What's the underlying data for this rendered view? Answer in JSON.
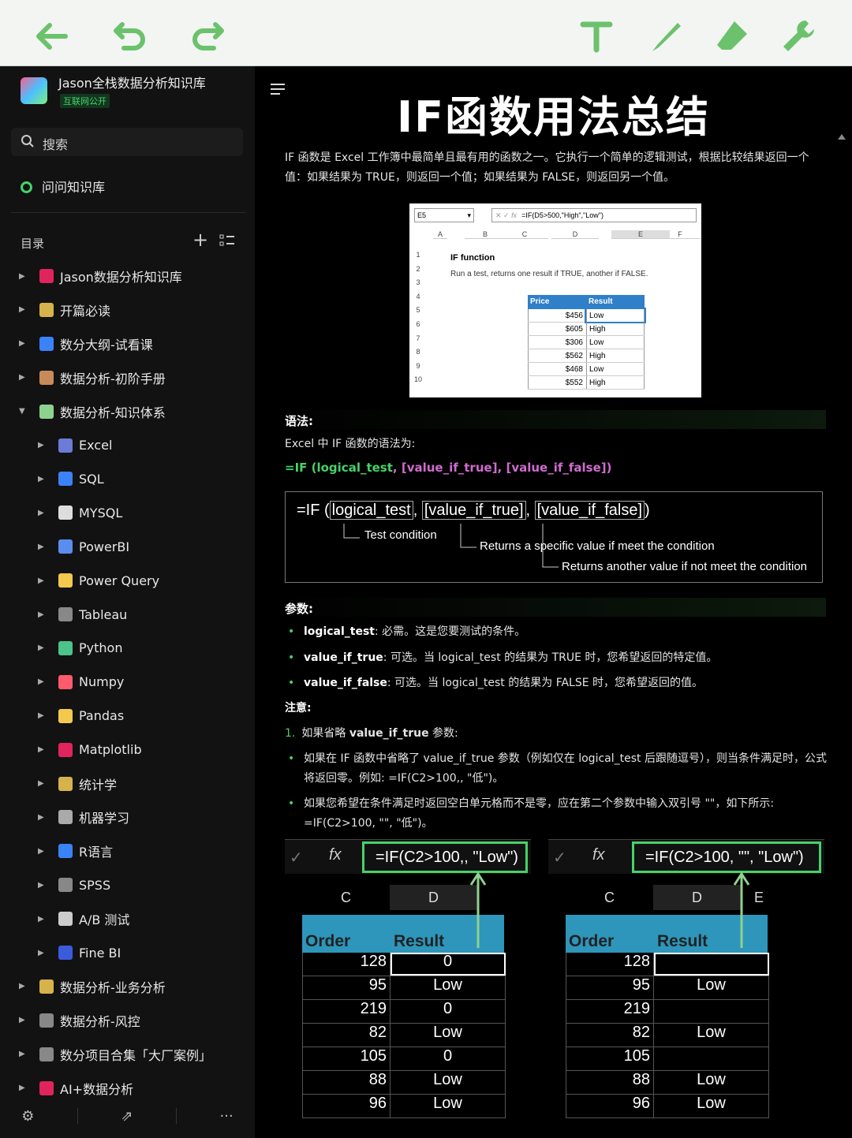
{
  "toolbar": {
    "icons": [
      "back-arrow-icon",
      "undo-icon",
      "redo-icon",
      "text-icon",
      "pen-icon",
      "eraser-icon",
      "wrench-icon"
    ],
    "accent": "#6cc26c"
  },
  "sidebar": {
    "workspace_name": "Jason全栈数据分析知识库",
    "workspace_tag": "互联网公开",
    "search_label": "搜索",
    "ask_label": "问问知识库",
    "toc_label": "目录",
    "items": [
      {
        "label": "Jason数据分析知识库",
        "level": 0,
        "icon": "folder-icon",
        "color": "#e0245e"
      },
      {
        "label": "开篇必读",
        "level": 0,
        "icon": "pencil-icon",
        "color": "#d6b24c"
      },
      {
        "label": "数分大纲-试看课",
        "level": 0,
        "icon": "diamond-icon",
        "color": "#3b82f6"
      },
      {
        "label": "数据分析-初阶手册",
        "level": 0,
        "icon": "hourglass-icon",
        "color": "#c98a5a"
      },
      {
        "label": "数据分析-知识体系",
        "level": 0,
        "icon": "music-icon",
        "color": "#8fd18f",
        "expanded": true
      },
      {
        "label": "Excel",
        "level": 1,
        "icon": "excel-icon",
        "color": "#6c7bd6"
      },
      {
        "label": "SQL",
        "level": 1,
        "icon": "sql-icon",
        "color": "#3b82f6"
      },
      {
        "label": "MYSQL",
        "level": 1,
        "icon": "mysql-icon",
        "color": "#dddddd"
      },
      {
        "label": "PowerBI",
        "level": 1,
        "icon": "powerbi-icon",
        "color": "#5b8def"
      },
      {
        "label": "Power Query",
        "level": 1,
        "icon": "powerquery-icon",
        "color": "#f2c94c"
      },
      {
        "label": "Tableau",
        "level": 1,
        "icon": "tableau-icon",
        "color": "#888888"
      },
      {
        "label": "Python",
        "level": 1,
        "icon": "python-icon",
        "color": "#4cc38a"
      },
      {
        "label": "Numpy",
        "level": 1,
        "icon": "numpy-icon",
        "color": "#ff5a6e"
      },
      {
        "label": "Pandas",
        "level": 1,
        "icon": "pandas-icon",
        "color": "#f2c94c"
      },
      {
        "label": "Matplotlib",
        "level": 1,
        "icon": "matplotlib-icon",
        "color": "#e0245e"
      },
      {
        "label": "统计学",
        "level": 1,
        "icon": "stats-icon",
        "color": "#d6b24c"
      },
      {
        "label": "机器学习",
        "level": 1,
        "icon": "robot-icon",
        "color": "#aaaaaa"
      },
      {
        "label": "R语言",
        "level": 1,
        "icon": "r-icon",
        "color": "#3b82f6"
      },
      {
        "label": "SPSS",
        "level": 1,
        "icon": "spss-icon",
        "color": "#888888"
      },
      {
        "label": "A/B 测试",
        "level": 1,
        "icon": "ab-icon",
        "color": "#cccccc"
      },
      {
        "label": "Fine BI",
        "level": 1,
        "icon": "finebi-icon",
        "color": "#3b5bdb"
      },
      {
        "label": "数据分析-业务分析",
        "level": 0,
        "icon": "trophy-icon",
        "color": "#d6b24c"
      },
      {
        "label": "数据分析-风控",
        "level": 0,
        "icon": "bird-icon",
        "color": "#888888"
      },
      {
        "label": "数分项目合集「大厂案例」",
        "level": 0,
        "icon": "link-icon",
        "color": "#888888"
      },
      {
        "label": "AI+数据分析",
        "level": 0,
        "icon": "ai-icon",
        "color": "#e0245e"
      }
    ],
    "footer_icons": [
      "settings-icon",
      "share-icon",
      "more-icon"
    ]
  },
  "article": {
    "title": "IF函数用法总结",
    "intro": "IF 函数是 Excel 工作簿中最简单且最有用的函数之一。它执行一个简单的逻辑测试，根据比较结果返回一个值：如果结果为 TRUE，则返回一个值；如果结果为 FALSE，则返回另一个值。",
    "fig1": {
      "namebox": "E5",
      "formula": "=IF(D5>500,\"High\",\"Low\")",
      "cols": [
        "A",
        "B",
        "C",
        "D",
        "E",
        "F"
      ],
      "rows": [
        "1",
        "2",
        "3",
        "4",
        "5",
        "6",
        "7",
        "8",
        "9",
        "10"
      ],
      "heading": "IF function",
      "subheading": "Run a test, returns one result if TRUE, another if FALSE.",
      "table_headers": [
        "Price",
        "Result"
      ],
      "table_rows": [
        [
          "$456",
          "Low"
        ],
        [
          "$605",
          "High"
        ],
        [
          "$306",
          "Low"
        ],
        [
          "$562",
          "High"
        ],
        [
          "$468",
          "Low"
        ],
        [
          "$552",
          "High"
        ]
      ]
    },
    "syntax_heading": "语法:",
    "syntax_intro": "Excel 中 IF 函数的语法为:",
    "syntax_formula": {
      "prefix": "=IF (",
      "a1": "logical_test",
      "sep1": ", [",
      "a2": "value_if_true",
      "sep2": "], [",
      "a3": "value_if_false",
      "suffix": "])"
    },
    "diagram": {
      "formula": {
        "p": "=IF (",
        "a": "logical_test",
        "b": "[value_if_true]",
        "c": "[value_if_false]",
        "end": ")"
      },
      "l1": "Test condition",
      "l2": "Returns a specific value if meet the condition",
      "l3": "Returns another value if not meet the condition"
    },
    "params_heading": "参数:",
    "params": [
      {
        "name": "logical_test",
        "desc": ": 必需。这是您要测试的条件。"
      },
      {
        "name": "value_if_true",
        "desc": ": 可选。当 logical_test 的结果为 TRUE 时，您希望返回的特定值。"
      },
      {
        "name": "value_if_false",
        "desc": ": 可选。当 logical_test 的结果为 FALSE 时，您希望返回的值。"
      }
    ],
    "note_heading": "注意:",
    "note1": {
      "num": "1.",
      "text": "如果省略 ",
      "bold": "value_if_true",
      "tail": " 参数:"
    },
    "note_b1": "如果在 IF 函数中省略了 value_if_true 参数（例如仅在 logical_test 后跟随逗号），则当条件满足时，公式将返回零。例如: =IF(C2>100,, \"低\")。",
    "note_b2": "如果您希望在条件满足时返回空白单元格而不是零，应在第二个参数中输入双引号 \"\"，如下所示: =IF(C2>100, \"\", \"低\")。",
    "ex_left": {
      "formula": "=IF(C2>100,, \"Low\")",
      "cols": [
        "C",
        "D"
      ],
      "headers": [
        "Order",
        "Result"
      ],
      "rows": [
        [
          "128",
          "0"
        ],
        [
          "95",
          "Low"
        ],
        [
          "219",
          "0"
        ],
        [
          "82",
          "Low"
        ],
        [
          "105",
          "0"
        ],
        [
          "88",
          "Low"
        ],
        [
          "96",
          "Low"
        ]
      ]
    },
    "ex_right": {
      "formula": "=IF(C2>100, \"\", \"Low\")",
      "cols": [
        "C",
        "D",
        "E"
      ],
      "headers": [
        "Order",
        "Result"
      ],
      "rows": [
        [
          "128",
          ""
        ],
        [
          "95",
          "Low"
        ],
        [
          "219",
          ""
        ],
        [
          "82",
          "Low"
        ],
        [
          "105",
          ""
        ],
        [
          "88",
          "Low"
        ],
        [
          "96",
          "Low"
        ]
      ]
    }
  }
}
